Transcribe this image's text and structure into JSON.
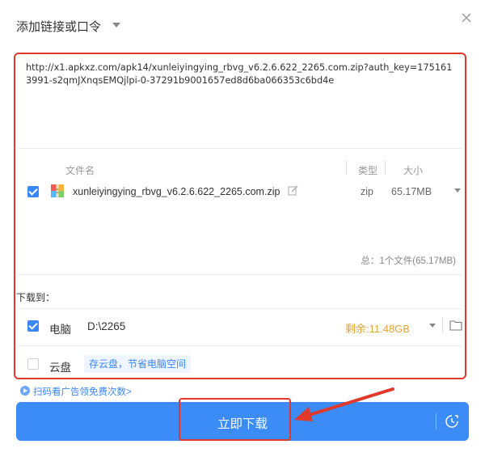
{
  "dialog": {
    "title": "添加链接或口令"
  },
  "url_input": {
    "value": "http://x1.apkxz.com/apk14/xunleiyingying_rbvg_v6.2.6.622_2265.com.zip?auth_key=1751613991-s2qmJXnqsEMQjlpi-0-37291b9001657ed8d6ba066353c6bd4e"
  },
  "file_list": {
    "headers": {
      "name": "文件名",
      "type": "类型",
      "size": "大小"
    },
    "files": [
      {
        "name": "xunleiyingying_rbvg_v6.2.6.622_2265.com.zip",
        "type": "zip",
        "size": "65.17MB",
        "checked": true
      }
    ],
    "summary": "总：1个文件(65.17MB)"
  },
  "download_to": {
    "label": "下载到：",
    "pc": {
      "label": "电脑",
      "checked": true,
      "path": "D:\\2265",
      "remaining": "剩余:11.48GB"
    },
    "cloud": {
      "label": "云盘",
      "checked": false,
      "tag": "存云盘，节省电脑空间"
    }
  },
  "promo": {
    "text": "扫码看广告领免费次数>"
  },
  "download_button": {
    "label": "立即下载"
  },
  "colors": {
    "accent": "#3b8cf6",
    "highlight_red": "#e0392b",
    "remaining_orange": "#e8a23a"
  }
}
